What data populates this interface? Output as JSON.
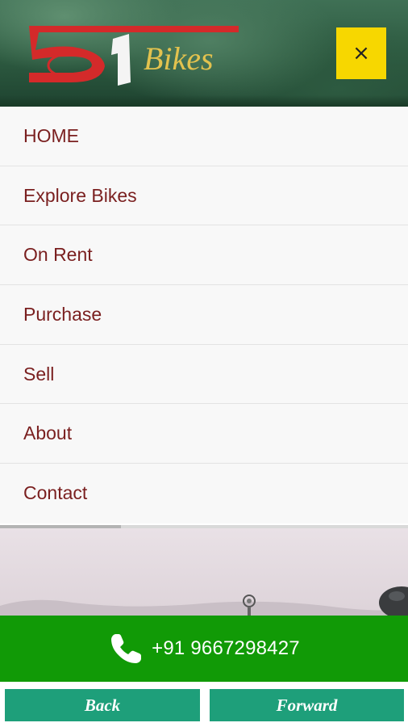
{
  "header": {
    "logo": {
      "number_text": "51",
      "brand_text": "Bikes",
      "colors": {
        "number": "#d42a2a",
        "digit_one": "#ffffff",
        "brand": "#e3c24e"
      }
    },
    "close": {
      "label": "×",
      "background": "#f7d700"
    }
  },
  "menu": {
    "text_color": "#7a1f1f",
    "items": [
      {
        "label": "HOME"
      },
      {
        "label": "Explore Bikes"
      },
      {
        "label": "On Rent"
      },
      {
        "label": "Purchase"
      },
      {
        "label": "Sell"
      },
      {
        "label": "About"
      },
      {
        "label": "Contact"
      }
    ]
  },
  "call_bar": {
    "icon": "phone-icon",
    "phone_number": "+91 9667298427",
    "background": "#119a06"
  },
  "navigation": {
    "back_label": "Back",
    "forward_label": "Forward",
    "button_color": "#1e9f7a"
  }
}
